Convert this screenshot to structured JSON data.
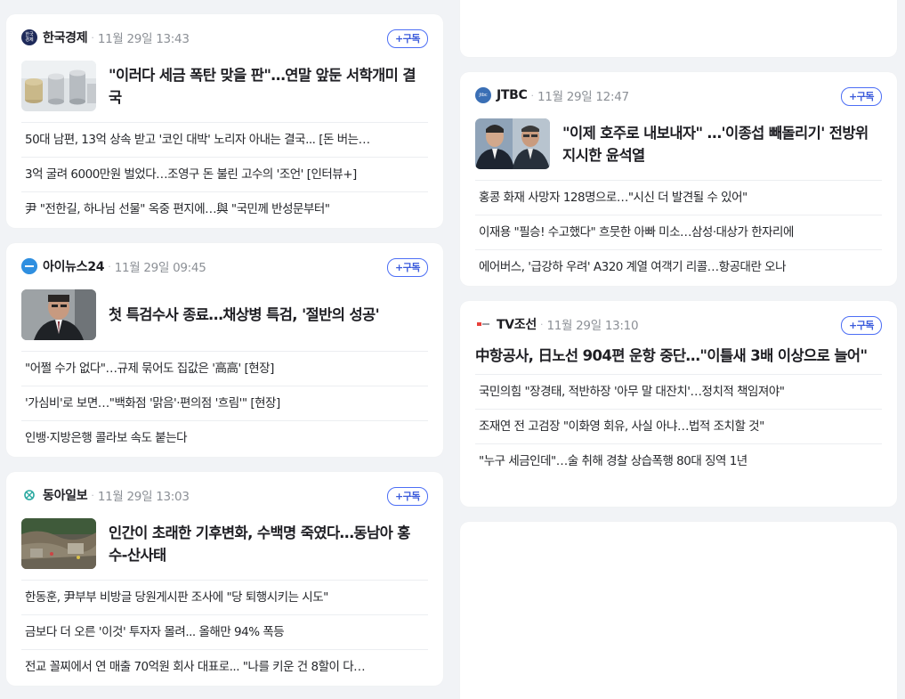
{
  "subscribe_label": "+구독",
  "cards": [
    {
      "press_name": "한국경제",
      "logo_text": "한국\n경제",
      "logo_color": "#1e2a5a",
      "time": "11월 29일 13:43",
      "headline": "\"이러다 세금 폭탄 맞을 판\"…연말 앞둔 서학개미 결국",
      "thumb": "coins",
      "items": [
        "50대 남편, 13억 상속 받고 '코인 대박' 노리자 아내는 결국... [돈 버는…",
        "3억 굴려 6000만원 벌었다…조영구 돈 불린 고수의 '조언' [인터뷰+]",
        "尹 \"전한길, 하나님 선물\" 옥중 편지에…與 \"국민께 반성문부터\""
      ]
    },
    {
      "press_name": "아이뉴스24",
      "logo_text": "",
      "logo_color": "#2f8fe0",
      "time": "11월 29일 09:45",
      "headline": "첫 특검수사 종료…채상병 특검, '절반의 성공'",
      "thumb": "portrait",
      "items": [
        "\"어쩔 수가 없다\"…규제 묶어도 집값은 '高高' [현장]",
        "'가심비'로 보면…\"백화점 '맑음'·편의점 '흐림'\" [현장]",
        "인뱅·지방은행 콜라보 속도 붙는다"
      ]
    },
    {
      "press_name": "동아일보",
      "logo_text": "",
      "logo_color": "#2aa9a0",
      "time": "11월 29일 13:03",
      "headline": "인간이 초래한 기후변화, 수백명 죽였다…동남아 홍수-산사태",
      "thumb": "landslide",
      "items": [
        "한동훈, 尹부부 비방글 당원게시판 조사에 \"당 퇴행시키는 시도\"",
        "금보다 더 오른 '이것' 투자자 몰려... 올해만 94% 폭등",
        "전교 꼴찌에서 연 매출 70억원 회사 대표로... \"나를 키운 건 8할이 다…"
      ]
    },
    {
      "press_name": "JTBC",
      "logo_text": "jtbc",
      "logo_color": "#3a6fb5",
      "time": "11월 29일 12:47",
      "headline": "\"이제 호주로 내보내자\" …'이종섭 빼돌리기' 전방위 지시한 윤석열",
      "thumb": "twomen",
      "items": [
        "홍콩 화재 사망자 128명으로…\"시신 더 발견될 수 있어\"",
        "이재용 \"필승! 수고했다\" 흐뭇한 아빠 미소…삼성·대상가 한자리에",
        "에어버스, '급강하 우려' A320 계열 여객기 리콜…항공대란 오나"
      ]
    },
    {
      "press_name": "TV조선",
      "logo_text": "",
      "logo_color": "#e8403a",
      "time": "11월 29일 13:10",
      "headline": "中항공사, 日노선 904편 운항 중단…\"이틀새 3배 이상으로 늘어\"",
      "thumb": "",
      "items": [
        "국민의힘 \"장경태, 적반하장 '아무 말 대잔치'…정치적 책임져야\"",
        "조재연 전 고검장 \"이화영 회유, 사실 아냐…법적 조치할 것\"",
        "\"누구 세금인데\"…술 취해 경찰 상습폭행 80대 징역 1년"
      ]
    }
  ]
}
